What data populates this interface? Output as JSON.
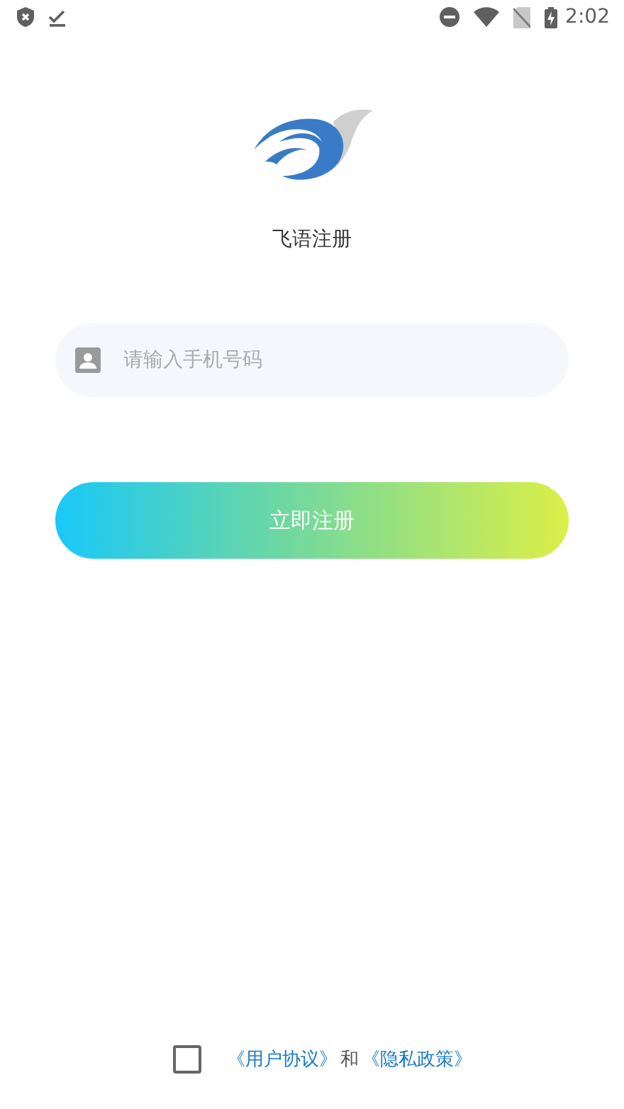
{
  "status_bar": {
    "time": "2:02"
  },
  "app_title": "飞语注册",
  "phone_field": {
    "placeholder": "请输入手机号码"
  },
  "register_button": "立即注册",
  "agreement": {
    "checked": false,
    "link_1": "《用户协议》",
    "conjunction": "和",
    "link_2": "《隐私政策》"
  }
}
